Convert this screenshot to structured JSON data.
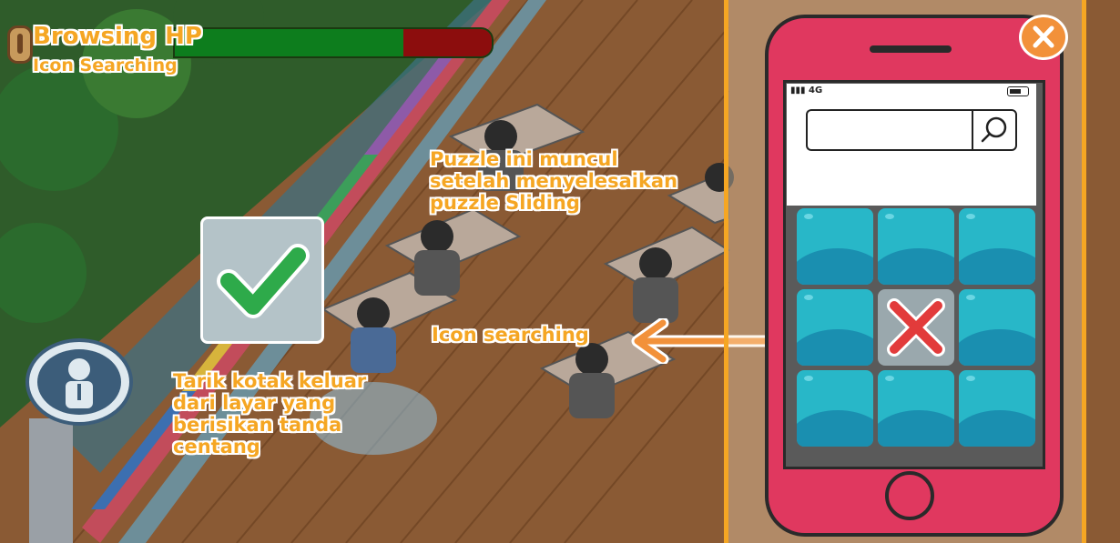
{
  "hud": {
    "title": "Browsing HP",
    "subtitle": "Icon Searching",
    "bar_remaining": 0.72
  },
  "annotations": {
    "top_note": [
      "Puzzle ini muncul",
      "setelah menyelesaikan",
      "puzzle Sliding"
    ],
    "arrow_label": "Icon searching",
    "left_note": [
      "Tarik kotak keluar",
      "dari layar yang",
      "berisikan tanda",
      "centang"
    ]
  },
  "phone": {
    "signal": "4G",
    "search_value": "",
    "grid_rows": 3,
    "grid_cols": 3,
    "empty_tile": "center",
    "close_icon": "close-icon",
    "search_icon": "search-icon"
  },
  "colors": {
    "annotation": "#f5a623",
    "phone_body": "#e0385f",
    "hp_full": "#0d7d1d",
    "hp_lost": "#8c0d0d",
    "check": "#2eaa4a",
    "cross": "#e23b3b",
    "tile": "#28b7c8"
  }
}
